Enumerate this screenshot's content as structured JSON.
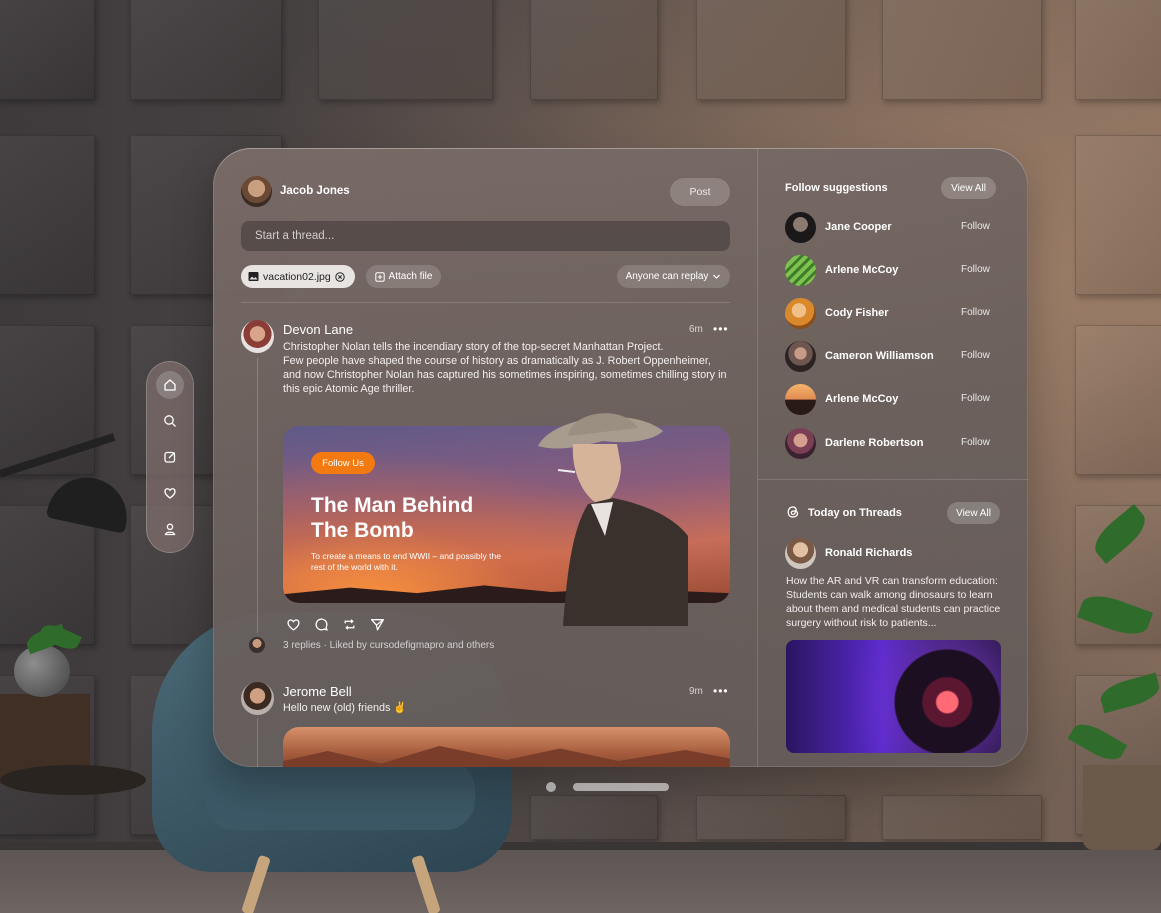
{
  "compose": {
    "user_name": "Jacob Jones",
    "post_label": "Post",
    "placeholder": "Start a thread...",
    "attachment_name": "vacation02.jpg",
    "attach_label": "Attach file",
    "reply_permission": "Anyone can replay"
  },
  "posts": [
    {
      "author": "Devon Lane",
      "time": "6m",
      "more": "•••",
      "text_1": "Christopher Nolan tells the incendiary story of the top-secret Manhattan Project.",
      "text_2": "Few people have shaped the course of history as dramatically as J. Robert Oppenheimer, and now Christopher Nolan has captured his sometimes inspiring, sometimes chilling story in this epic Atomic Age thriller.",
      "card": {
        "badge": "Follow Us",
        "title_line1": "The Man Behind",
        "title_line2": "The Bomb",
        "subtitle": "To create a means to end WWII – and possibly the rest of the world with it."
      },
      "reply_info": "3 replies · Liked by cursodefigmapro and others"
    },
    {
      "author": "Jerome Bell",
      "time": "9m",
      "more": "•••",
      "text": "Hello new (old) friends ✌"
    }
  ],
  "suggestions": {
    "title": "Follow suggestions",
    "view_all": "View All",
    "follow_label": "Follow",
    "items": [
      {
        "name": "Jane Cooper"
      },
      {
        "name": "Arlene McCoy"
      },
      {
        "name": "Cody Fisher"
      },
      {
        "name": "Cameron Williamson"
      },
      {
        "name": "Arlene McCoy"
      },
      {
        "name": "Darlene Robertson"
      }
    ]
  },
  "today": {
    "title": "Today on Threads",
    "view_all": "View All",
    "author": "Ronald Richards",
    "text": "How the AR and VR can transform education: Students can walk among dinosaurs to learn about them and medical students can practice surgery without risk to patients..."
  },
  "nav": {
    "items": [
      "home-icon",
      "search-icon",
      "compose-icon",
      "heart-icon",
      "profile-icon"
    ],
    "active": "home-icon"
  },
  "colors": {
    "accent": "#f27a10"
  }
}
